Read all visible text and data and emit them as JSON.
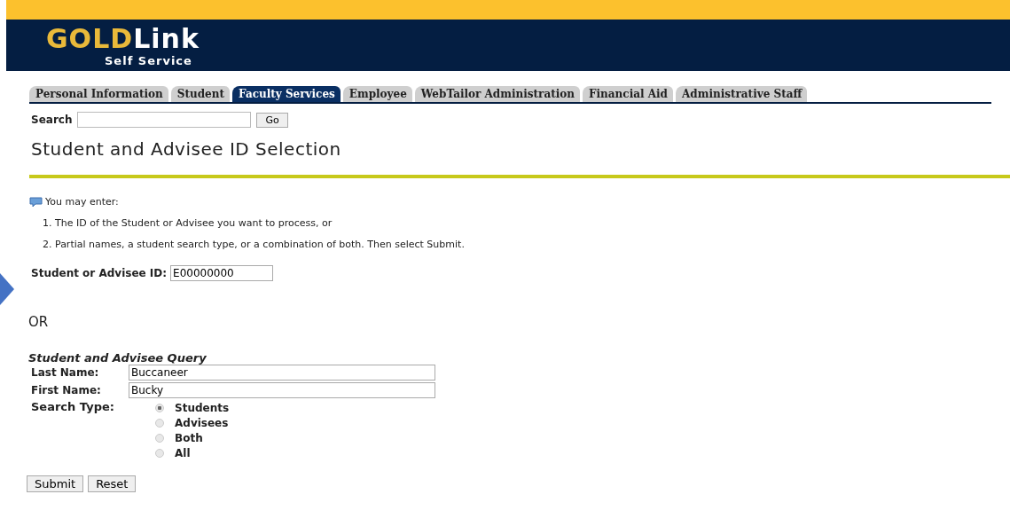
{
  "header": {
    "logo_gold": "GOLD",
    "logo_link": "Link",
    "subtitle": "Self Service"
  },
  "tabs": [
    {
      "label": "Personal Information",
      "selected": false
    },
    {
      "label": "Student",
      "selected": false
    },
    {
      "label": "Faculty Services",
      "selected": true
    },
    {
      "label": "Employee",
      "selected": false
    },
    {
      "label": "WebTailor Administration",
      "selected": false
    },
    {
      "label": "Financial Aid",
      "selected": false
    },
    {
      "label": "Administrative Staff",
      "selected": false
    }
  ],
  "search": {
    "label": "Search",
    "button": "Go"
  },
  "page_title": "Student and Advisee ID Selection",
  "info": {
    "intro": "You may enter:",
    "items": [
      "1. The ID of the Student or Advisee you want to process, or",
      "2. Partial names, a student search type, or a combination of both. Then select Submit."
    ]
  },
  "id_field": {
    "label": "Student or Advisee ID:",
    "value": "E00000000"
  },
  "or_text": "OR",
  "query": {
    "title": "Student and Advisee Query",
    "fields": [
      {
        "label": "Last Name:",
        "value": "Buccaneer"
      },
      {
        "label": "First Name:",
        "value": "Bucky"
      }
    ],
    "search_type_label": "Search Type:",
    "options": [
      {
        "label": "Students",
        "selected": true
      },
      {
        "label": "Advisees",
        "selected": false
      },
      {
        "label": "Both",
        "selected": false
      },
      {
        "label": "All",
        "selected": false
      }
    ]
  },
  "buttons": [
    "Submit",
    "Reset"
  ]
}
